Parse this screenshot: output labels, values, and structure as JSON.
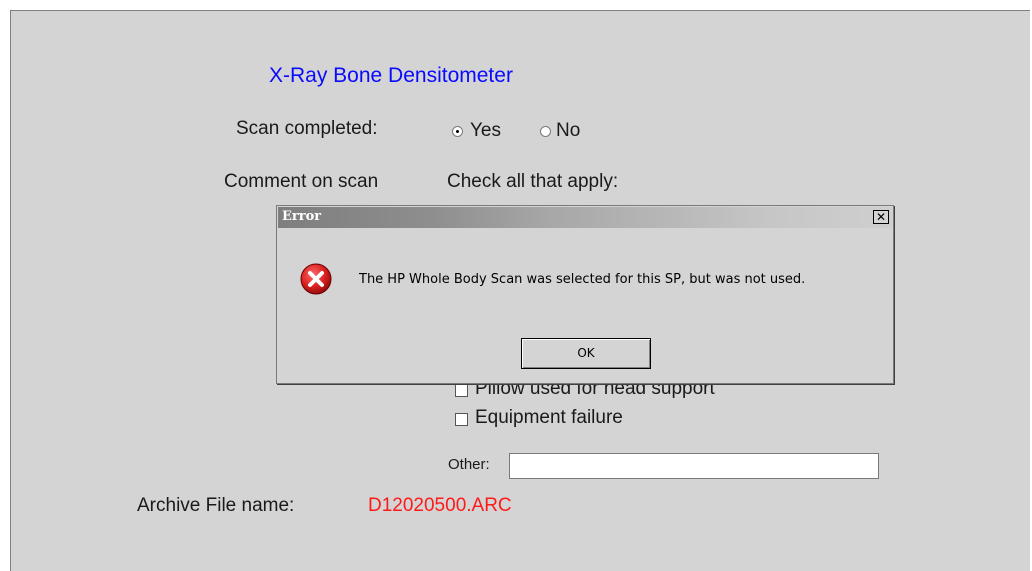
{
  "form": {
    "title": "X-Ray Bone Densitometer",
    "scan_completed": {
      "label": "Scan completed:",
      "options": [
        "Yes",
        "No"
      ],
      "selected": "Yes"
    },
    "comment": {
      "label": "Comment on scan",
      "hint": "Check all that apply:"
    },
    "checkboxes": [
      {
        "label": "Pillow used for head support",
        "checked": false
      },
      {
        "label": "Equipment failure",
        "checked": false
      }
    ],
    "other": {
      "label": "Other:",
      "value": ""
    },
    "archive": {
      "label": "Archive File name:",
      "value": "D12020500.ARC"
    }
  },
  "dialog": {
    "title": "Error",
    "close_glyph": "✕",
    "message": "The HP Whole Body Scan was selected for this SP, but was not used.",
    "ok_label": "OK",
    "icon": "error-x-icon"
  },
  "colors": {
    "panel_bg": "#d4d4d4",
    "title_text": "#0a0aff",
    "archive_value": "#ff1a1a",
    "error_icon": "#d81e1e"
  }
}
